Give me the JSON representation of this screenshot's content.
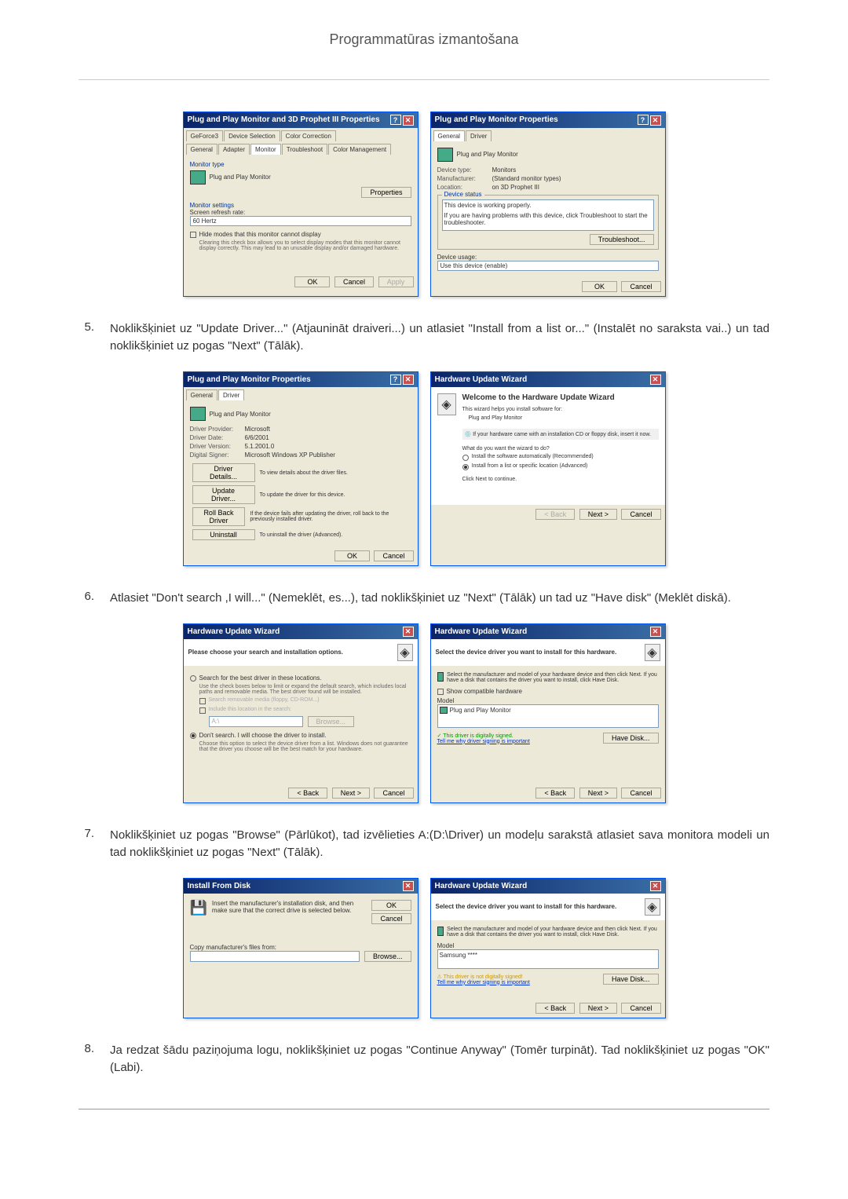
{
  "page_title": "Programmatūras izmantošana",
  "steps": {
    "5": {
      "num": "5.",
      "text": "Noklikšķiniet uz \"Update Driver...\" (Atjaunināt draiveri...) un atlasiet \"Install from a list or...\" (Instalēt no saraksta vai..) un tad noklikšķiniet uz pogas \"Next\" (Tālāk)."
    },
    "6": {
      "num": "6.",
      "text": "Atlasiet \"Don't search ,I will...\" (Nemeklēt, es...), tad noklikšķiniet uz \"Next\" (Tālāk) un tad uz \"Have disk\" (Meklēt diskā)."
    },
    "7": {
      "num": "7.",
      "text": "Noklikšķiniet uz pogas \"Browse\" (Pārlūkot), tad izvēlieties A:(D:\\Driver) un modeļu sarakstā atlasiet sava monitora modeli un tad noklikšķiniet uz pogas \"Next\" (Tālāk)."
    },
    "8": {
      "num": "8.",
      "text": "Ja redzat šādu paziņojuma logu, noklikšķiniet uz pogas \"Continue Anyway\" (Tomēr turpināt). Tad noklikšķiniet uz pogas \"OK\" (Labi)."
    }
  },
  "buttons": {
    "ok": "OK",
    "cancel": "Cancel",
    "apply": "Apply",
    "back": "< Back",
    "next": "Next >",
    "browse": "Browse...",
    "properties": "Properties",
    "troubleshoot": "Troubleshoot...",
    "have_disk": "Have Disk...",
    "driver_details": "Driver Details...",
    "update_driver": "Update Driver...",
    "rollback": "Roll Back Driver",
    "uninstall": "Uninstall"
  },
  "dlg1": {
    "title": "Plug and Play Monitor and 3D Prophet III Properties",
    "tabs": [
      "GeForce3",
      "Device Selection",
      "Color Correction",
      "General",
      "Adapter",
      "Monitor",
      "Troubleshoot",
      "Color Management"
    ],
    "monitor_type": "Monitor type",
    "monitor_name": "Plug and Play Monitor",
    "monitor_settings": "Monitor settings",
    "refresh_label": "Screen refresh rate:",
    "refresh_value": "60 Hertz",
    "hide_modes": "Hide modes that this monitor cannot display",
    "hide_desc": "Clearing this check box allows you to select display modes that this monitor cannot display correctly. This may lead to an unusable display and/or damaged hardware."
  },
  "dlg2": {
    "title": "Plug and Play Monitor Properties",
    "tabs": [
      "General",
      "Driver"
    ],
    "name": "Plug and Play Monitor",
    "device_type": "Device type:",
    "device_type_val": "Monitors",
    "manufacturer": "Manufacturer:",
    "manufacturer_val": "(Standard monitor types)",
    "location": "Location:",
    "location_val": "on 3D Prophet III",
    "device_status": "Device status",
    "status_text": "This device is working properly.",
    "trouble_text": "If you are having problems with this device, click Troubleshoot to start the troubleshooter.",
    "device_usage": "Device usage:",
    "usage_val": "Use this device (enable)"
  },
  "dlg3": {
    "title": "Plug and Play Monitor Properties",
    "tabs": [
      "General",
      "Driver"
    ],
    "name": "Plug and Play Monitor",
    "provider": "Driver Provider:",
    "provider_val": "Microsoft",
    "date": "Driver Date:",
    "date_val": "6/6/2001",
    "version": "Driver Version:",
    "version_val": "5.1.2001.0",
    "signer": "Digital Signer:",
    "signer_val": "Microsoft Windows XP Publisher",
    "details_desc": "To view details about the driver files.",
    "update_desc": "To update the driver for this device.",
    "rollback_desc": "If the device fails after updating the driver, roll back to the previously installed driver.",
    "uninstall_desc": "To uninstall the driver (Advanced)."
  },
  "dlg4": {
    "title": "Hardware Update Wizard",
    "welcome": "Welcome to the Hardware Update Wizard",
    "helps": "This wizard helps you install software for:",
    "device": "Plug and Play Monitor",
    "cd_hint": "If your hardware came with an installation CD or floppy disk, insert it now.",
    "what_do": "What do you want the wizard to do?",
    "opt1": "Install the software automatically (Recommended)",
    "opt2": "Install from a list or specific location (Advanced)",
    "click_next": "Click Next to continue."
  },
  "dlg5": {
    "title": "Hardware Update Wizard",
    "header": "Please choose your search and installation options.",
    "opt1": "Search for the best driver in these locations.",
    "opt1_desc": "Use the check boxes below to limit or expand the default search, which includes local paths and removable media. The best driver found will be installed.",
    "chk1": "Search removable media (floppy, CD-ROM...)",
    "chk2": "Include this location in the search:",
    "opt2": "Don't search. I will choose the driver to install.",
    "opt2_desc": "Choose this option to select the device driver from a list. Windows does not guarantee that the driver you choose will be the best match for your hardware."
  },
  "dlg6": {
    "title": "Hardware Update Wizard",
    "header": "Select the device driver you want to install for this hardware.",
    "desc": "Select the manufacturer and model of your hardware device and then click Next. If you have a disk that contains the driver you want to install, click Have Disk.",
    "compat": "Show compatible hardware",
    "model": "Model",
    "model_item": "Plug and Play Monitor",
    "signed": "This driver is digitally signed.",
    "tell_why": "Tell me why driver signing is important"
  },
  "dlg7": {
    "title": "Install From Disk",
    "text": "Insert the manufacturer's installation disk, and then make sure that the correct drive is selected below.",
    "copy": "Copy manufacturer's files from:"
  },
  "dlg8": {
    "title": "Hardware Update Wizard",
    "header": "Select the device driver you want to install for this hardware.",
    "desc": "Select the manufacturer and model of your hardware device and then click Next. If you have a disk that contains the driver you want to install, click Have Disk.",
    "model": "Model",
    "model_item": "Samsung ****",
    "not_signed": "This driver is not digitally signed!",
    "tell_why": "Tell me why driver signing is important"
  }
}
